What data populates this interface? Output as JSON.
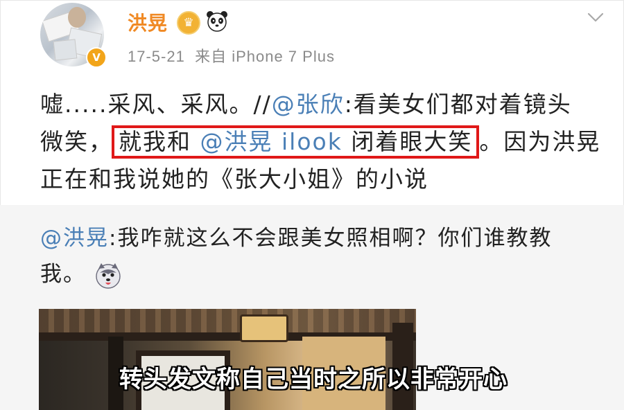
{
  "post": {
    "author": {
      "name": "洪晃",
      "verified_badge": "V",
      "crown_icon": "crown-icon",
      "panda_icon": "panda-icon"
    },
    "meta": {
      "date": "17-5-21",
      "source": "来自 iPhone 7 Plus"
    },
    "text": {
      "line1_pre": "嘘.....采风、采风。//",
      "line1_mention": "@张欣",
      "line1_post": ":看美女们都对着镜头",
      "line2_pre": "微笑，",
      "highlight_pre": "就我和 ",
      "highlight_mention": "@洪晃 ilook",
      "highlight_post": " 闭着眼大笑",
      "line2_post": "。因为洪晃",
      "line3": "正在和我说她的《张大小姐》的小说"
    }
  },
  "repost": {
    "mention": "@洪晃",
    "text": ":我咋就这么不会跟美女照相啊？你们谁教教我。",
    "emoji": "husky-icon"
  },
  "video": {
    "subtitle": "转头发文称自己当时之所以非常开心"
  },
  "colors": {
    "username": "#f08a25",
    "link": "#4a7fb6",
    "highlight_border": "#e01818",
    "meta": "#8a8a8a",
    "repost_bg": "#f5f5f5"
  }
}
